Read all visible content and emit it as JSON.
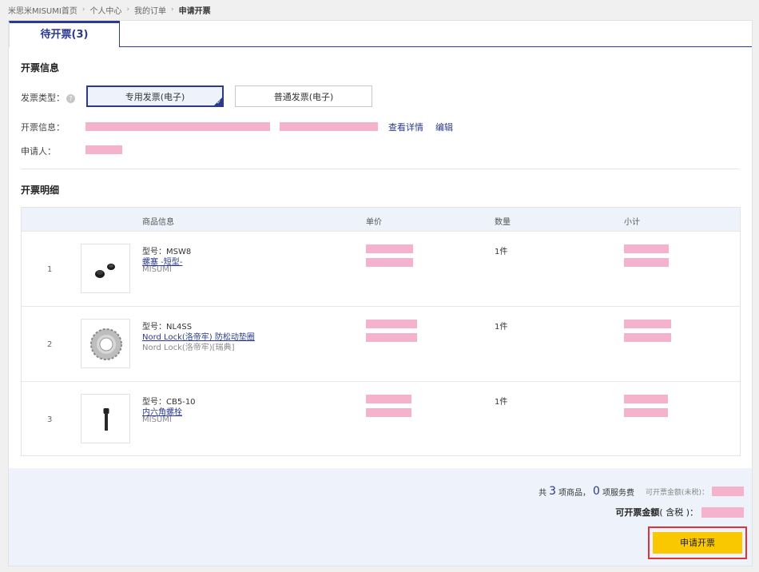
{
  "breadcrumb": [
    "米思米MISUMI首页",
    "个人中心",
    "我的订单",
    "申请开票"
  ],
  "tab": {
    "label": "待开票(3)"
  },
  "invoice_info": {
    "title": "开票信息",
    "type_label": "发票类型：",
    "type_options": [
      "专用发票(电子)",
      "普通发票(电子)"
    ],
    "selected_type": "专用发票(电子)",
    "info_label": "开票信息：",
    "view_details": "查看详情",
    "edit": "编辑",
    "applicant_label": "申请人："
  },
  "detail": {
    "title": "开票明细",
    "columns": [
      "商品信息",
      "单价",
      "数量",
      "小计"
    ],
    "rows": [
      {
        "index": "1",
        "model": "型号：MSW8",
        "name": "螺塞 -短型-",
        "brand": "MISUMI",
        "qty": "1件"
      },
      {
        "index": "2",
        "model": "型号：NL4SS",
        "name": "Nord Lock(洛帝牢) 防松动垫圈",
        "brand": "Nord Lock(洛帝牢)[瑞典]",
        "qty": "1件"
      },
      {
        "index": "3",
        "model": "型号：CB5-10",
        "name": "内六角螺栓",
        "brand": "MISUMI",
        "qty": "1件"
      }
    ]
  },
  "summary": {
    "total_prefix": "共",
    "product_count": "3",
    "product_suffix": "项商品，",
    "service_count": "0",
    "service_suffix": "项服务费",
    "amount_excl_label": "可开票金额(未税)：",
    "amount_incl_label": "可开票金额",
    "amount_incl_note": "( 含税 )：",
    "apply_button": "申请开票"
  },
  "colors": {
    "accent": "#2a3a8c",
    "button": "#f9c800",
    "highlight": "#e03333",
    "redaction": "#f4b2cc"
  }
}
